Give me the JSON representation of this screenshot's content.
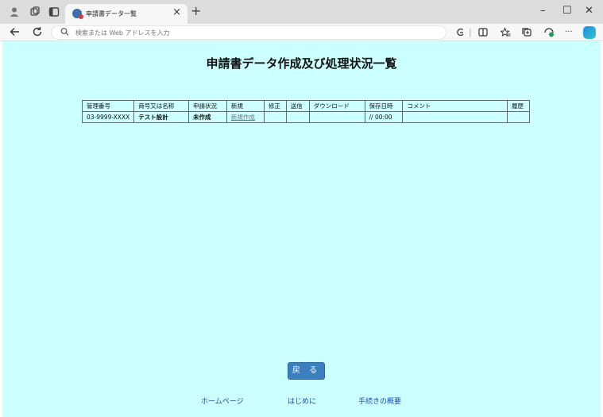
{
  "browser": {
    "tab_title": "申請書データ一覧",
    "tab_close": "×",
    "new_tab": "+",
    "address_placeholder": "検索または Web アドレスを入力",
    "window_controls": {
      "minimize": "–",
      "maximize": "☐",
      "close": "✕"
    },
    "icons": [
      "profile-icon",
      "workspaces-icon",
      "tab-actions-icon",
      "back-icon",
      "refresh-icon",
      "search-icon",
      "extensions-icon",
      "split-screen-icon",
      "favorites-icon",
      "collections-icon",
      "browser-essentials-icon",
      "more-icon",
      "copilot-icon"
    ]
  },
  "page": {
    "title": "申請書データ作成及び処理状況一覧",
    "background": "#ccffff",
    "table": {
      "headers": [
        "管理番号",
        "商号又は名称",
        "申請状況",
        "新規",
        "修正",
        "送信",
        "ダウンロード",
        "保存日時",
        "コメント",
        "履歴"
      ],
      "rows": [
        [
          "03-9999-XXXX",
          "テスト設計",
          "未作成",
          "新規作成",
          "",
          "",
          "",
          "// 00:00",
          "",
          ""
        ]
      ]
    },
    "back_button": "戻 る",
    "footer_links": [
      "ホームページ",
      "はじめに",
      "手続きの概要"
    ]
  },
  "colors": {
    "button": "#3c7fbe",
    "link": "#1a4db8"
  }
}
